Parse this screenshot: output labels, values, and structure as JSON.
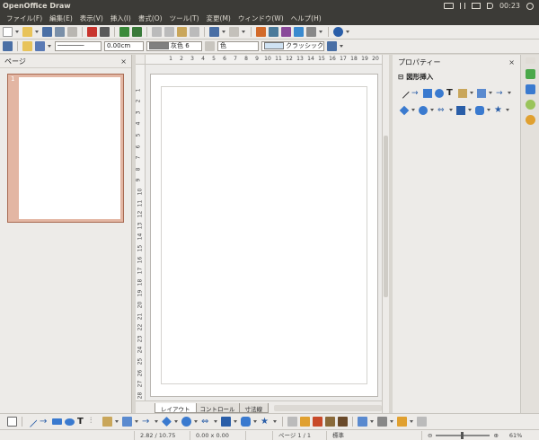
{
  "app": {
    "title": "OpenOffice Draw"
  },
  "system_tray": {
    "clock": "00:23"
  },
  "menus": [
    "ファイル(F)",
    "編集(E)",
    "表示(V)",
    "挿入(I)",
    "書式(O)",
    "ツール(T)",
    "変更(M)",
    "ウィンドウ(W)",
    "ヘルプ(H)"
  ],
  "line_toolbar": {
    "line_width": "0.00cm",
    "line_color": "灰色 6",
    "area_style": "色",
    "area_color": "クラッシック",
    "line_color_swatch": "#808080",
    "area_color_swatch": "#cfe2f3"
  },
  "pages_panel": {
    "title": "ページ",
    "close_label": "×",
    "thumbnail_number": "1"
  },
  "ruler": {
    "horizontal": [
      "1",
      "2",
      "3",
      "4",
      "5",
      "6",
      "7",
      "8",
      "9",
      "10",
      "11",
      "12",
      "13",
      "14",
      "15",
      "16",
      "17",
      "18",
      "19",
      "20"
    ],
    "vertical": [
      "1",
      "2",
      "3",
      "4",
      "5",
      "6",
      "7",
      "8",
      "9",
      "10",
      "11",
      "12",
      "13",
      "14",
      "15",
      "16",
      "17",
      "18",
      "19",
      "20",
      "21",
      "22",
      "23",
      "24",
      "25",
      "26",
      "27",
      "28"
    ]
  },
  "tabs": [
    "レイアウト",
    "コントロール",
    "寸法線"
  ],
  "properties": {
    "title": "プロパティー",
    "close_label": "×",
    "section": "図形挿入",
    "section_toggle": "⊟"
  },
  "statusbar": {
    "position": "2.82 / 10.75",
    "size": "0.00 x 0.00",
    "page": "ページ 1 / 1",
    "style": "標準",
    "zoom": "61%"
  }
}
